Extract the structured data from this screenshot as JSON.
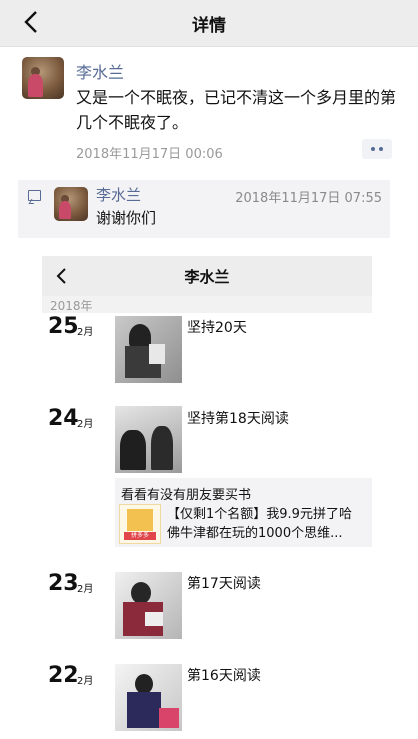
{
  "detail": {
    "nav_title": "详情",
    "post": {
      "author": "李水兰",
      "content": "又是一个不眠夜，已记不清这一个多月里的第几个不眠夜了。",
      "time": "2018年11月17日 00:06"
    },
    "comment": {
      "author": "李水兰",
      "time": "2018年11月17日 07:55",
      "text": "谢谢你们"
    }
  },
  "album": {
    "nav_title": "李水兰",
    "year": "2018年",
    "entries": [
      {
        "day": "25",
        "month": "2月",
        "caption": "坚持20天"
      },
      {
        "day": "24",
        "month": "2月",
        "caption": "坚持第18天阅读"
      },
      {
        "day": "23",
        "month": "2月",
        "caption": "第17天阅读"
      },
      {
        "day": "22",
        "month": "2月",
        "caption": "第16天阅读"
      }
    ],
    "share": {
      "text": "看看有没有朋友要买书",
      "desc_line1": "【仅剩1个名额】我9.9元拼了哈",
      "desc_line2": "佛牛津都在玩的1000个思维...",
      "badge": "拼多多"
    }
  }
}
